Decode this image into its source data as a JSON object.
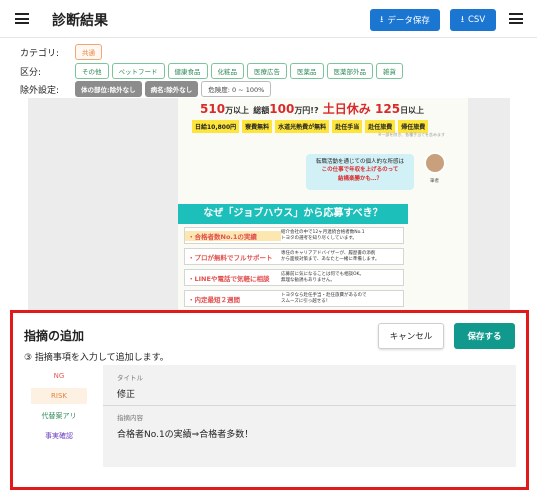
{
  "header": {
    "title": "診断結果",
    "data_save_label": "データ保存",
    "csv_label": "CSV"
  },
  "filters": {
    "category_label": "カテゴリ:",
    "category_tag": "共通",
    "kubun_label": "区分:",
    "kubun_tags": [
      "その他",
      "ペットフード",
      "健康食品",
      "化粧品",
      "医療広告",
      "医薬品",
      "医薬部外品",
      "雑貨"
    ],
    "exclude_label": "除外設定:",
    "exclude_tags": [
      "体の部位:除外なし",
      "病名:除外なし"
    ],
    "danger_tag": "危険度: 0 ~ 100%"
  },
  "doc": {
    "headline": [
      "510",
      "万以上",
      "総額",
      "100",
      "万円!?",
      "土日休み",
      "125",
      "日以上"
    ],
    "yellow": [
      "日給10,800円",
      "寮費無料",
      "水道光熱費が無料",
      "赴任手当",
      "赴任旅費",
      "帰任旅費"
    ],
    "note": "※一部を除き、各種手当てを含みます",
    "speech_l1": "転職活動を通じての個人的な所感は",
    "speech_l2": "この仕事で年収を上げるのって",
    "speech_l3": "結構楽勝かも…？",
    "avatar_cap": "筆者",
    "teal_title": "なぜ「ジョブハウス」から応募すべき？",
    "features": [
      {
        "label": "・合格者数No.1の実績",
        "text1": "紹介会社の中で12ヶ月連続合格者数No.1",
        "text2": "トヨタの選考を知り尽くしています。"
      },
      {
        "label": "・プロが無料でフルサポート",
        "text1": "専任のキャリアアドバイザーが、履歴書の添削",
        "text2": "から面接対策まで、あなたと一緒に準備します。"
      },
      {
        "label": "・LINEや電話で気軽に相談",
        "text1": "応募前に気になることは何でも相談OK。",
        "text2": "無理な勧誘もありません。"
      },
      {
        "label": "・内定最短２週間",
        "text1": "トヨタなら赴任手当・赴任旅費があるので",
        "text2": "スムーズに引っ越せる！"
      }
    ]
  },
  "panel": {
    "title": "指摘の追加",
    "subtitle": "③ 指摘事項を入力して追加します。",
    "cancel_label": "キャンセル",
    "save_label": "保存する",
    "categories": [
      "NG",
      "RISK",
      "代替案アリ",
      "事実確認"
    ],
    "title_field_label": "タイトル",
    "title_field_value": "修正",
    "content_field_label": "指摘内容",
    "content_field_value": "合格者No.1の実績⇒合格者多数！"
  },
  "colors": {
    "accent_blue": "#1b76d2",
    "save_teal": "#11998e",
    "highlight_red": "#e21919",
    "risk_orange": "#e8833a"
  },
  "icons": [
    "menu-icon",
    "download-icon",
    "avatar-photo"
  ]
}
